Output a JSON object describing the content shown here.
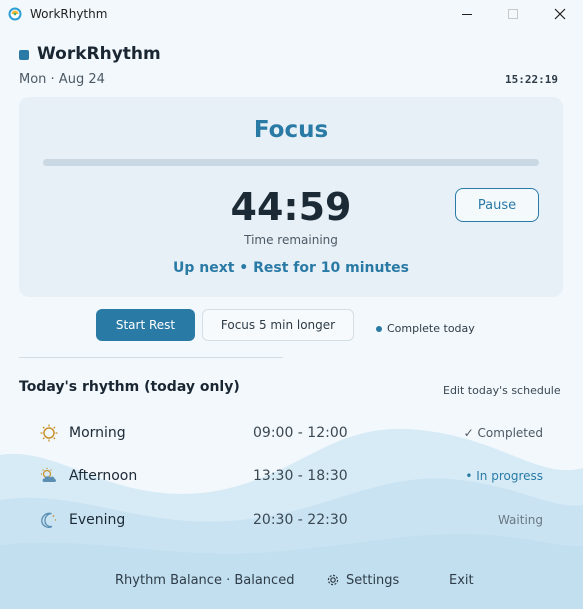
{
  "window": {
    "title": "WorkRhythm"
  },
  "header": {
    "title": "WorkRhythm",
    "date": "Mon · Aug 24",
    "clock": "15:22:19"
  },
  "focus": {
    "label": "Focus",
    "progress_fraction": 0.0,
    "time_remaining": "44:59",
    "time_caption": "Time remaining",
    "up_next": "Up next • Rest for 10 minutes",
    "pause_label": "Pause"
  },
  "actions": {
    "start_rest_label": "Start Rest",
    "longer_label": "Focus 5 min longer",
    "complete_today_label": "Complete today"
  },
  "rhythm": {
    "title": "Today's rhythm (today only)",
    "edit_label": "Edit today's schedule",
    "items": [
      {
        "name": "Morning",
        "time": "09:00 - 12:00",
        "status": "✓ Completed",
        "icon": "sun-icon"
      },
      {
        "name": "Afternoon",
        "time": "13:30 - 18:30",
        "status": "• In progress",
        "icon": "cloud-sun-icon"
      },
      {
        "name": "Evening",
        "time": "20:30 - 22:30",
        "status": "Waiting",
        "icon": "moon-icon"
      }
    ]
  },
  "footer": {
    "balance": "Rhythm Balance · Balanced",
    "settings_label": "Settings",
    "exit_label": "Exit"
  },
  "colors": {
    "accent": "#2a7aa6",
    "card_bg": "#e7f0f7",
    "wave": "#c9e3f2"
  }
}
